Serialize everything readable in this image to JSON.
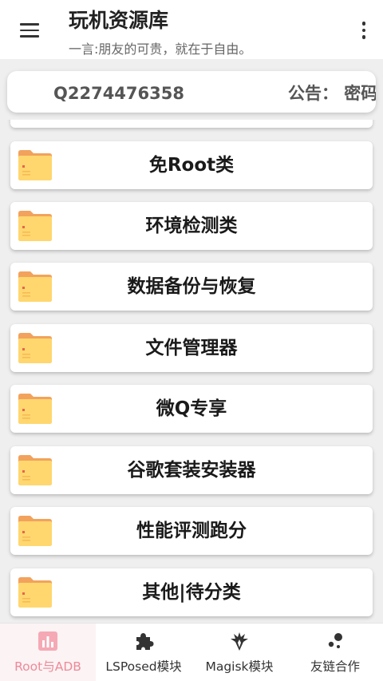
{
  "app_bar": {
    "title": "玩机资源库",
    "subtitle": "一言:朋友的可贵，就在于自由。"
  },
  "notice": {
    "contact_text": "Q2274476358",
    "announcement_text": "公告：  密码"
  },
  "colors": {
    "folder_body": "#ffd76e",
    "folder_tab": "#f2a25c",
    "folder_dot": "#e8654d",
    "nav_active": "#ee8a99"
  },
  "categories": [
    {
      "label": "免Root类",
      "icon": "folder-icon"
    },
    {
      "label": "环境检测类",
      "icon": "folder-icon"
    },
    {
      "label": "数据备份与恢复",
      "icon": "folder-icon"
    },
    {
      "label": "文件管理器",
      "icon": "folder-icon"
    },
    {
      "label": "微Q专享",
      "icon": "folder-icon"
    },
    {
      "label": "谷歌套装安装器",
      "icon": "folder-icon"
    },
    {
      "label": "性能评测跑分",
      "icon": "folder-icon"
    },
    {
      "label": "其他|待分类",
      "icon": "folder-icon"
    }
  ],
  "bottom_nav": [
    {
      "label": "Root与ADB",
      "icon": "bar-chart-icon",
      "active": true
    },
    {
      "label": "LSPosed模块",
      "icon": "puzzle-icon",
      "active": false
    },
    {
      "label": "Magisk模块",
      "icon": "magisk-icon",
      "active": false
    },
    {
      "label": "友链合作",
      "icon": "dots-icon",
      "active": false
    }
  ]
}
